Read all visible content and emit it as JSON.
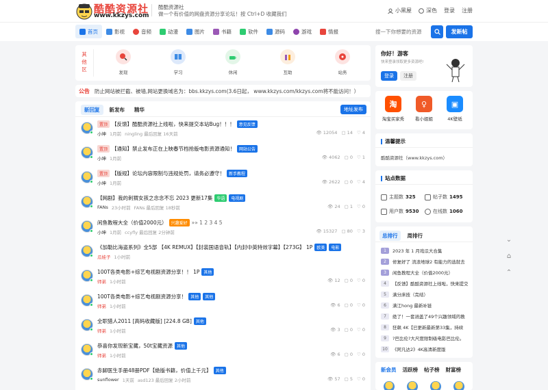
{
  "header": {
    "logo_text": "酷酷资源社",
    "logo_url": "www.kkzys.com",
    "site_name": "酷酷资源社",
    "slogan": "做一个有价值的网盘资源分享论坛！按 Ctrl+D 收藏我们",
    "links": [
      "小黑屋",
      "深色",
      "登录",
      "注册"
    ]
  },
  "nav": {
    "items": [
      "首页",
      "影视",
      "音频",
      "动漫",
      "图片",
      "书籍",
      "软件",
      "源码",
      "游戏",
      "情报"
    ],
    "search_placeholder": "搜一下你想要的资源",
    "post_label": "发新帖"
  },
  "zone": {
    "label": "其他区",
    "items": [
      "发现",
      "学习",
      "休闲",
      "互助",
      "站务"
    ]
  },
  "notice": {
    "tag": "公告",
    "text": "防止网站被拦截、被墙,网站更换域名为：bbs.kkzys.com(3.6日起， www.kkzys.com/kkzys.com将不能访问！）"
  },
  "feed": {
    "tabs": [
      "新回复",
      "新发布",
      "精华"
    ],
    "addr_btn": "地址发布",
    "threads": [
      {
        "pin": "置顶",
        "title": "【反馈】酷酷资源社上线啦，快来提交本站Bug！！！",
        "badges": [
          "意见反馈"
        ],
        "author": "小坤",
        "time": "1月前",
        "extra": "ningling  最后回复 16天前",
        "views": "12054",
        "replies": "14",
        "likes": "4"
      },
      {
        "pin": "置顶",
        "title": "【通知】禁止发布正在上映春节档抢版电影资源通知！",
        "badges": [
          "网站公告"
        ],
        "author": "小坤",
        "time": "1月前",
        "extra": "",
        "views": "4062",
        "replies": "0",
        "likes": "1"
      },
      {
        "pin": "置顶",
        "title": "【版规】论坛内容限制与违规处罚，请务必遵守！",
        "badges": [
          "新手教程"
        ],
        "author": "小坤",
        "time": "1月前",
        "extra": "",
        "views": "2622",
        "replies": "0",
        "likes": "4"
      },
      {
        "pin": "",
        "title": "【网剧】我的刺猬女孩之念念不忘 2023 更新17集",
        "badges": [
          "华语",
          "电视剧"
        ],
        "author": "FANs",
        "time": "23小时前",
        "extra": "FANs  最后回复 18秒前",
        "views": "24",
        "replies": "1",
        "likes": "0"
      },
      {
        "pin": "",
        "title": "闲鱼教程大全（价值2000元）",
        "badges": [
          "兴趣爱好"
        ],
        "pages": "»» 1 2 3 4 5",
        "author": "小坤",
        "time": "1月前",
        "extra": "ccyfly  最后回复 2分钟前",
        "views": "15327",
        "replies": "80",
        "likes": "3"
      },
      {
        "pin": "",
        "title": "《加勒比海盗系列》全5部 【4K REMUX】【封装国语音轨】【内封中英特效字幕】【273G】  1P",
        "badges": [
          "欧美",
          "电影"
        ],
        "author": "瓜娃子",
        "author_red": true,
        "time": "1小时前",
        "extra": "",
        "views": "",
        "replies": "",
        "likes": ""
      },
      {
        "pin": "",
        "title": "100T各类电影+综艺电视剧资源分享！！  1P",
        "badges": [
          "其他"
        ],
        "author": "师弟",
        "author_red": true,
        "time": "1小时前",
        "extra": "",
        "views": "12",
        "replies": "0",
        "likes": "0"
      },
      {
        "pin": "",
        "title": "100T各类电影+综艺电视剧资源分享！",
        "badges": [
          "其他",
          "其他"
        ],
        "author": "师弟",
        "author_red": true,
        "time": "1小时前",
        "extra": "",
        "views": "6",
        "replies": "0",
        "likes": "0"
      },
      {
        "pin": "",
        "title": "全职猎人2011 [高码收藏版] [224.8 GB]",
        "badges": [
          "其他"
        ],
        "author": "师弟",
        "author_red": true,
        "time": "1小时前",
        "extra": "",
        "views": "3",
        "replies": "0",
        "likes": "0"
      },
      {
        "pin": "",
        "title": "恭喜你发现新宝藏，50t宝藏资源",
        "badges": [
          "其他"
        ],
        "author": "师弟",
        "author_red": true,
        "time": "1小时前",
        "extra": "",
        "views": "6",
        "replies": "0",
        "likes": "0"
      },
      {
        "pin": "",
        "title": "赤脚医生手册48册PDF【绝版书籍，价值上千元】",
        "badges": [
          "其他"
        ],
        "author": "sunflower",
        "time": "1天前",
        "extra": "asd123  最后回复 2小时前",
        "views": "57",
        "replies": "5",
        "likes": "0"
      }
    ]
  },
  "user": {
    "hello": "你好！游客",
    "sub": "快来登录领取更多资源吧!",
    "login": "登录",
    "register": "注册"
  },
  "apps": [
    "淘宝买家秀",
    "看小姐姐",
    "4K壁纸"
  ],
  "tips": {
    "title": "温馨提示",
    "text": "酷酷资源社（www.kkzys.com）"
  },
  "stats": {
    "title": "站点数据",
    "topics_label": "主题数",
    "topics": "325",
    "posts_label": "帖子数",
    "posts": "1495",
    "users_label": "用户数",
    "users": "9530",
    "online_label": "在线数",
    "online": "1060"
  },
  "rank": {
    "tabs": [
      "总排行",
      "周排行"
    ],
    "items": [
      "2023 年 1 月戏瓜大合集",
      "修复好了 流浪地球2 有能力的选就去",
      "闲鱼教程大全（价值2000元）",
      "【反馈】酷酷资源社上线啦，快来提交",
      "满分床技（完结）",
      "满江hong 最新补链",
      "绝了！一套涵盖了49个兴趣领域的教",
      "狂飙 4K【已更新最新第33集，持续",
      "?巴比伦?大尺度限制级电影巴比伦。",
      "《阿凡达2》4K高清新度版"
    ]
  },
  "members": {
    "tabs": [
      "新会员",
      "活跃榜",
      "帖子榜",
      "财富榜"
    ]
  },
  "colors": {
    "accent": "#1a73e8",
    "red": "#e8453c",
    "bg": "#f4f5f7"
  }
}
